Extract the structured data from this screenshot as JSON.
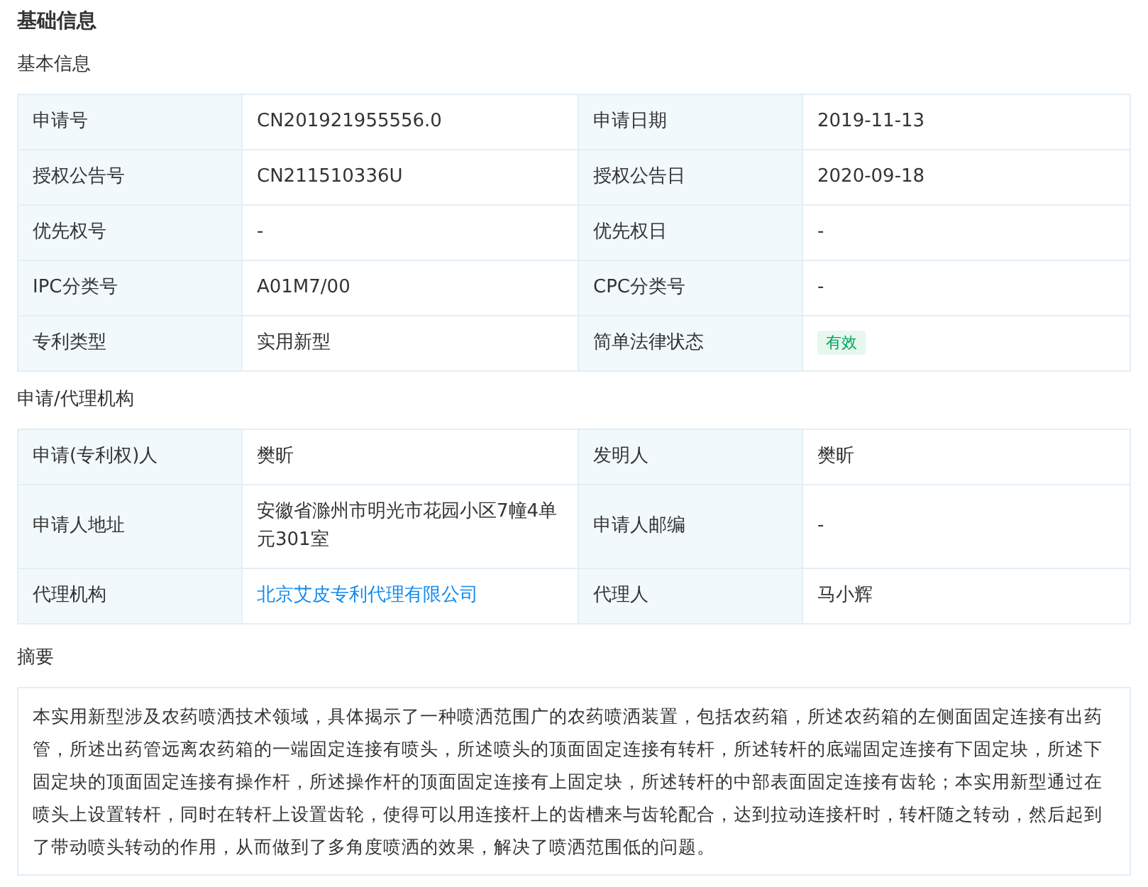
{
  "page_title": "基础信息",
  "sections": [
    {
      "title": "基本信息",
      "rows": [
        [
          {
            "label": "申请号",
            "value": "CN201921955556.0",
            "kind": "text"
          },
          {
            "label": "申请日期",
            "value": "2019-11-13",
            "kind": "text"
          }
        ],
        [
          {
            "label": "授权公告号",
            "value": "CN211510336U",
            "kind": "text"
          },
          {
            "label": "授权公告日",
            "value": "2020-09-18",
            "kind": "text"
          }
        ],
        [
          {
            "label": "优先权号",
            "value": "-",
            "kind": "text"
          },
          {
            "label": "优先权日",
            "value": "-",
            "kind": "text"
          }
        ],
        [
          {
            "label": "IPC分类号",
            "value": "A01M7/00",
            "kind": "text"
          },
          {
            "label": "CPC分类号",
            "value": "-",
            "kind": "text"
          }
        ],
        [
          {
            "label": "专利类型",
            "value": "实用新型",
            "kind": "text"
          },
          {
            "label": "简单法律状态",
            "value": "有效",
            "kind": "badge"
          }
        ]
      ]
    },
    {
      "title": "申请/代理机构",
      "rows": [
        [
          {
            "label": "申请(专利权)人",
            "value": "樊昕",
            "kind": "text"
          },
          {
            "label": "发明人",
            "value": "樊昕",
            "kind": "text"
          }
        ],
        [
          {
            "label": "申请人地址",
            "value": "安徽省滁州市明光市花园小区7幢4单元301室",
            "kind": "text"
          },
          {
            "label": "申请人邮编",
            "value": "-",
            "kind": "text"
          }
        ],
        [
          {
            "label": "代理机构",
            "value": "北京艾皮专利代理有限公司",
            "kind": "link"
          },
          {
            "label": "代理人",
            "value": "马小辉",
            "kind": "text"
          }
        ]
      ]
    }
  ],
  "abstract": {
    "title": "摘要",
    "text": "本实用新型涉及农药喷洒技术领域，具体揭示了一种喷洒范围广的农药喷洒装置，包括农药箱，所述农药箱的左侧面固定连接有出药管，所述出药管远离农药箱的一端固定连接有喷头，所述喷头的顶面固定连接有转杆，所述转杆的底端固定连接有下固定块，所述下固定块的顶面固定连接有操作杆，所述操作杆的顶面固定连接有上固定块，所述转杆的中部表面固定连接有齿轮；本实用新型通过在喷头上设置转杆，同时在转杆上设置齿轮，使得可以用连接杆上的齿槽来与齿轮配合，达到拉动连接杆时，转杆随之转动，然后起到了带动喷头转动的作用，从而做到了多角度喷洒的效果，解决了喷洒范围低的问题。"
  }
}
